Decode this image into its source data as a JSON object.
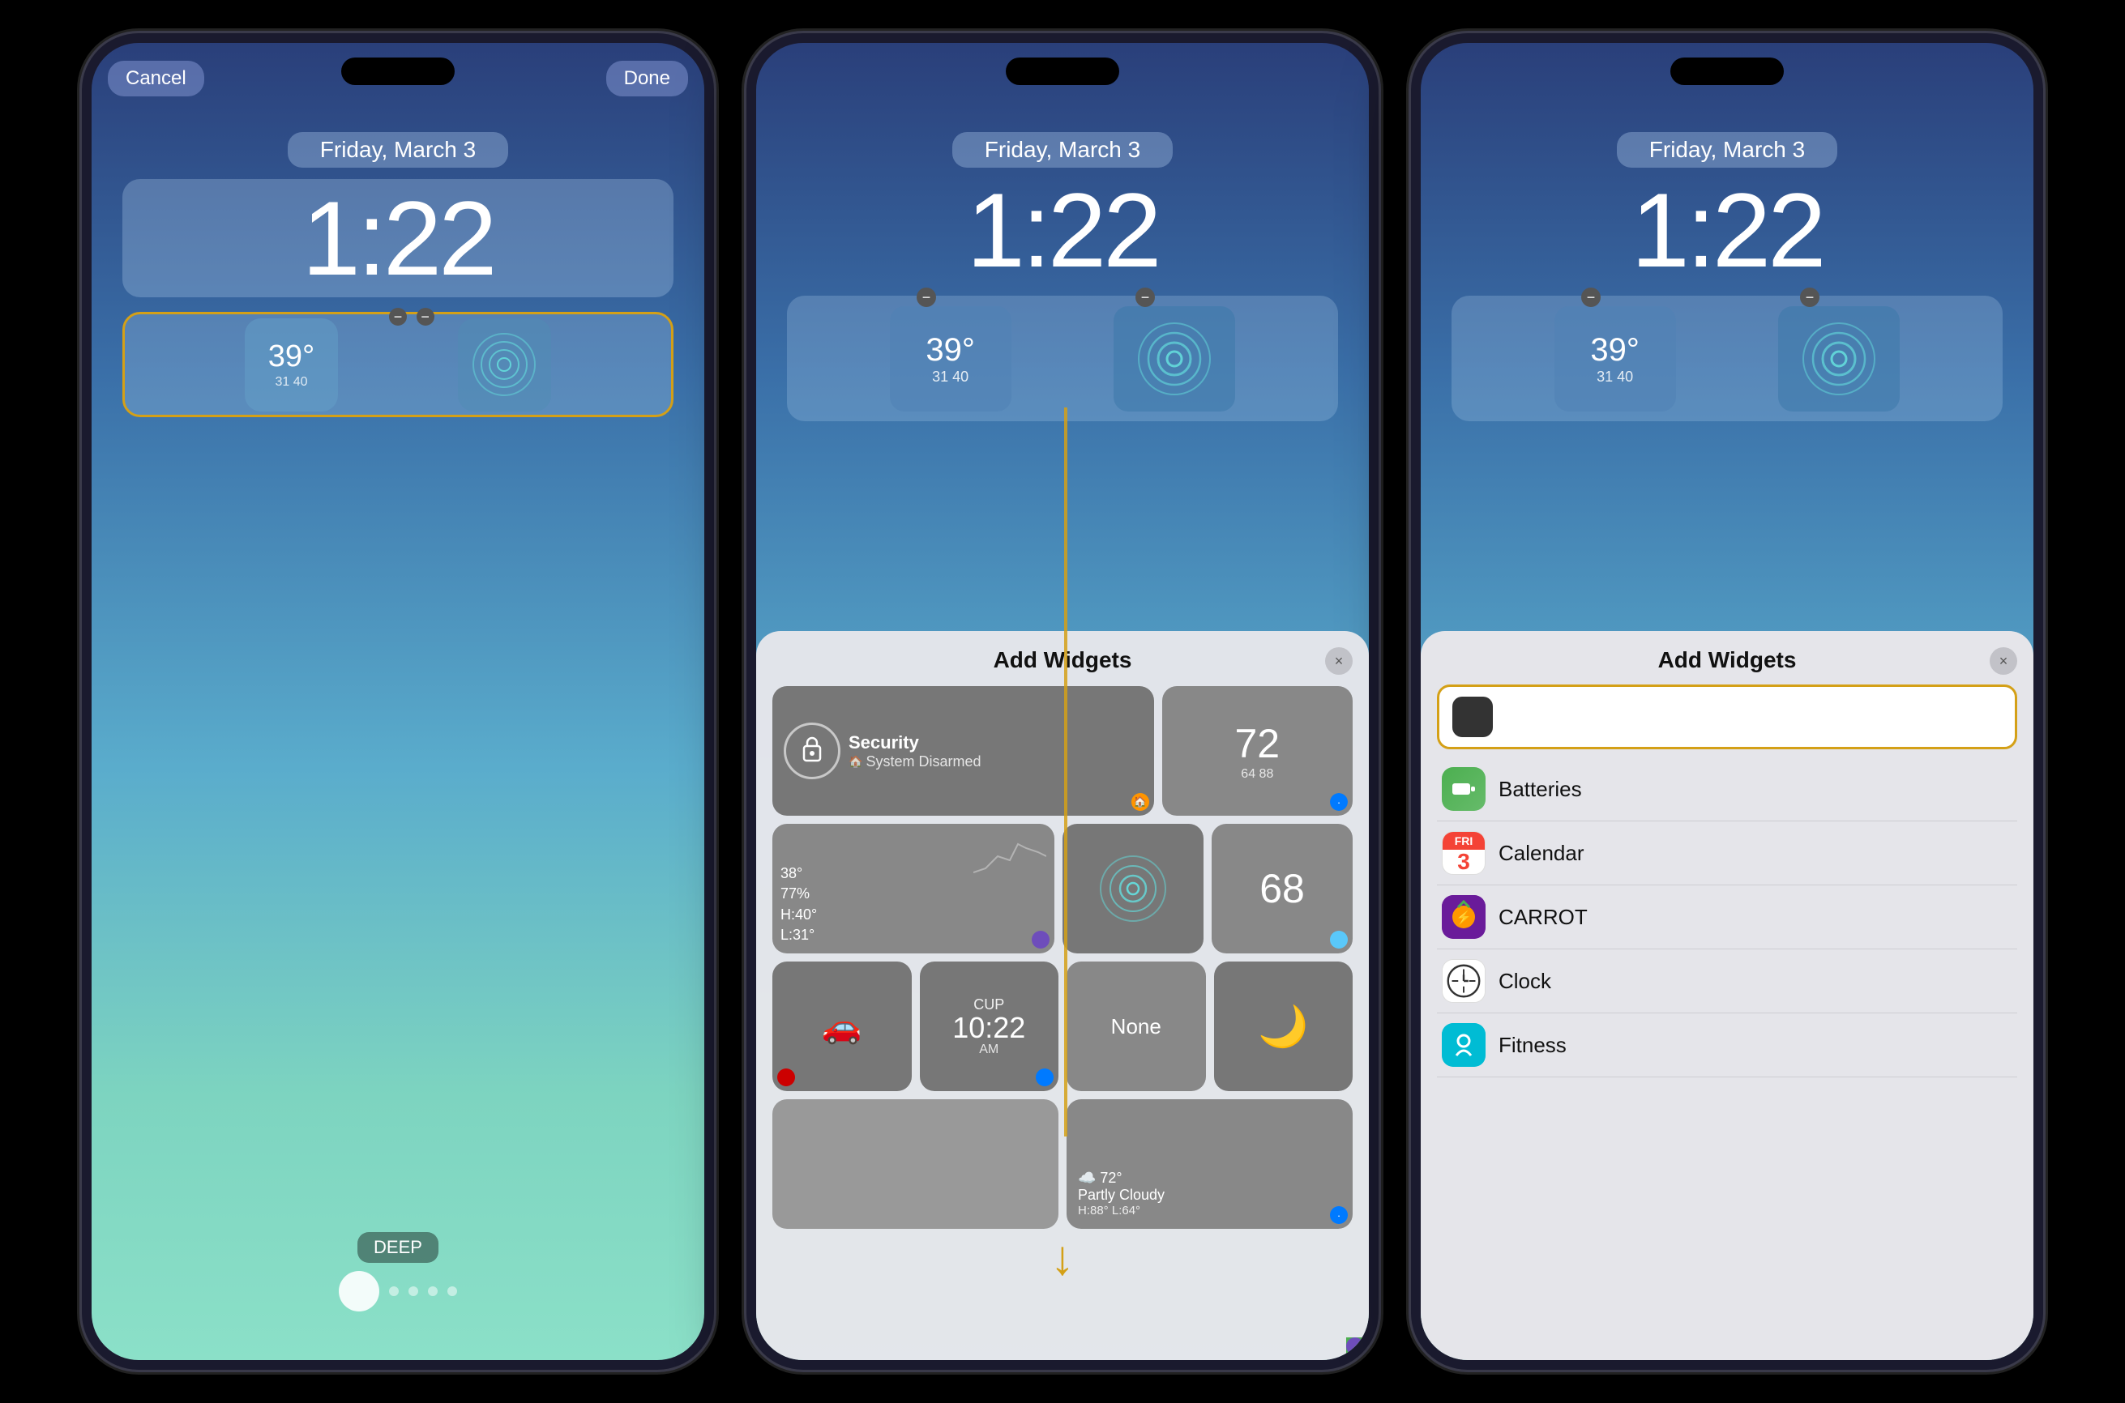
{
  "colors": {
    "accent": "#d4a017",
    "bg_gradient_top": "#2a3f7a",
    "bg_gradient_bottom": "#8be0c8",
    "panel_bg": "#e5e5ea"
  },
  "phone1": {
    "cancel_label": "Cancel",
    "done_label": "Done",
    "date": "Friday, March 3",
    "time": "1:22",
    "widget_temp": "39°",
    "widget_temp_sub": "31  40",
    "deep_label": "DEEP",
    "page_indicator": "active_dot_3_of_5"
  },
  "phone2": {
    "date": "Friday, March 3",
    "time": "1:22",
    "widget_temp": "39°",
    "widget_temp_sub": "31 40",
    "add_widgets_title": "Add Widgets",
    "close_label": "×",
    "widgets": {
      "security_title": "Security",
      "security_sub": "System Disarmed",
      "weather_num": "72",
      "weather_sub": "64  88",
      "chart_temp": "38°",
      "chart_humidity": "77%",
      "chart_high": "H:40°",
      "chart_low": "L:31°",
      "radar_widget": "radar",
      "humidity_num": "68",
      "cup_label": "CUP",
      "cup_time": "10:22",
      "cup_sub": "AM",
      "none_label": "None",
      "moon_widget": "moon",
      "partly_cloudy_temp": "☁️ 72°",
      "partly_cloudy_title": "Partly Cloudy",
      "partly_cloudy_sub": "H:88° L:64°"
    }
  },
  "phone3": {
    "date": "Friday, March 3",
    "time": "1:22",
    "widget_temp": "39°",
    "widget_temp_sub": "31 40",
    "add_widgets_title": "Add Widgets",
    "close_label": "×",
    "list_items": [
      {
        "id": "batteries",
        "label": "Batteries",
        "icon_color": "#4caf50"
      },
      {
        "id": "calendar",
        "label": "Calendar",
        "icon_color": "#fff",
        "icon_num": "3",
        "icon_day": "FRI"
      },
      {
        "id": "carrot",
        "label": "CARROT",
        "icon_color": "#6a1b9a"
      },
      {
        "id": "clock",
        "label": "Clock",
        "icon_color": "#fff"
      },
      {
        "id": "fitness",
        "label": "Fitness",
        "icon_color": "#00bcd4"
      }
    ]
  }
}
